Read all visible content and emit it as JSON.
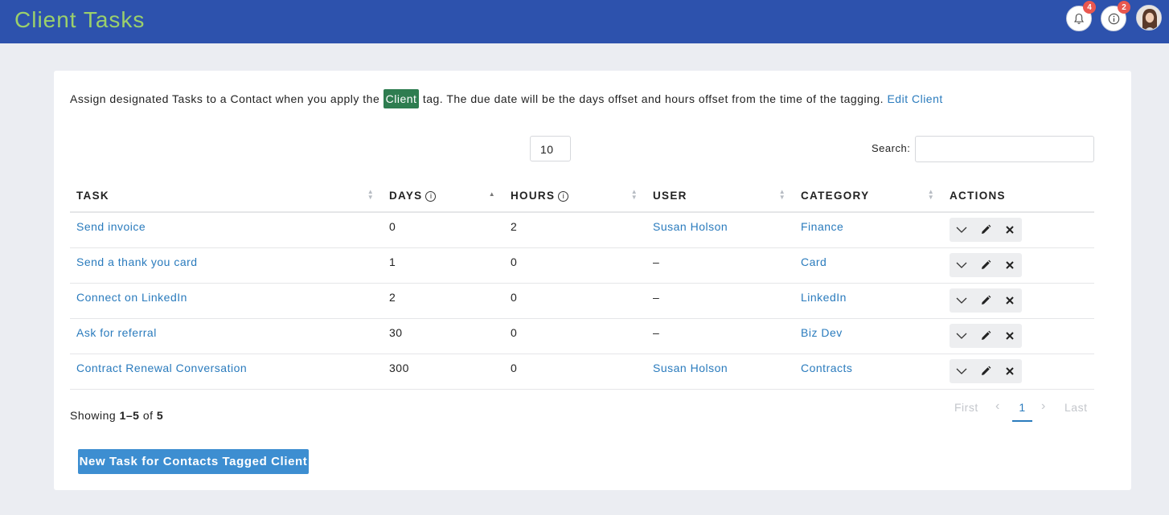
{
  "header": {
    "title": "Client Tasks",
    "notifications_count": "4",
    "info_count": "2"
  },
  "intro": {
    "before": "Assign designated Tasks to a Contact when you apply the",
    "tag": "Client",
    "after": "tag. The due date will be the days offset and hours offset from the time of the tagging.",
    "edit_link": "Edit Client"
  },
  "controls": {
    "page_length": "10",
    "search_label": "Search:",
    "search_value": ""
  },
  "table": {
    "columns": [
      "TASK",
      "DAYS",
      "HOURS",
      "USER",
      "CATEGORY",
      "ACTIONS"
    ],
    "rows": [
      {
        "task": "Send invoice",
        "days": "0",
        "hours": "2",
        "user": "Susan Holson",
        "category": "Finance"
      },
      {
        "task": "Send a thank you card",
        "days": "1",
        "hours": "0",
        "user": "–",
        "category": "Card"
      },
      {
        "task": "Connect on LinkedIn",
        "days": "2",
        "hours": "0",
        "user": "–",
        "category": "LinkedIn"
      },
      {
        "task": "Ask for referral",
        "days": "30",
        "hours": "0",
        "user": "–",
        "category": "Biz Dev"
      },
      {
        "task": "Contract Renewal Conversation",
        "days": "300",
        "hours": "0",
        "user": "Susan Holson",
        "category": "Contracts"
      }
    ]
  },
  "footer": {
    "showing_prefix": "Showing",
    "showing_range": "1–5",
    "showing_of": "of",
    "showing_total": "5",
    "pager": {
      "first": "First",
      "prev": "‹",
      "current": "1",
      "next": "›",
      "last": "Last"
    },
    "new_task_button": "New Task for Contacts Tagged Client"
  },
  "colors": {
    "header_bg": "#2d52ad",
    "title": "#9bd06b",
    "tag_bg": "#2e7d50",
    "link": "#2a7bbd",
    "button": "#3d8ed1"
  }
}
